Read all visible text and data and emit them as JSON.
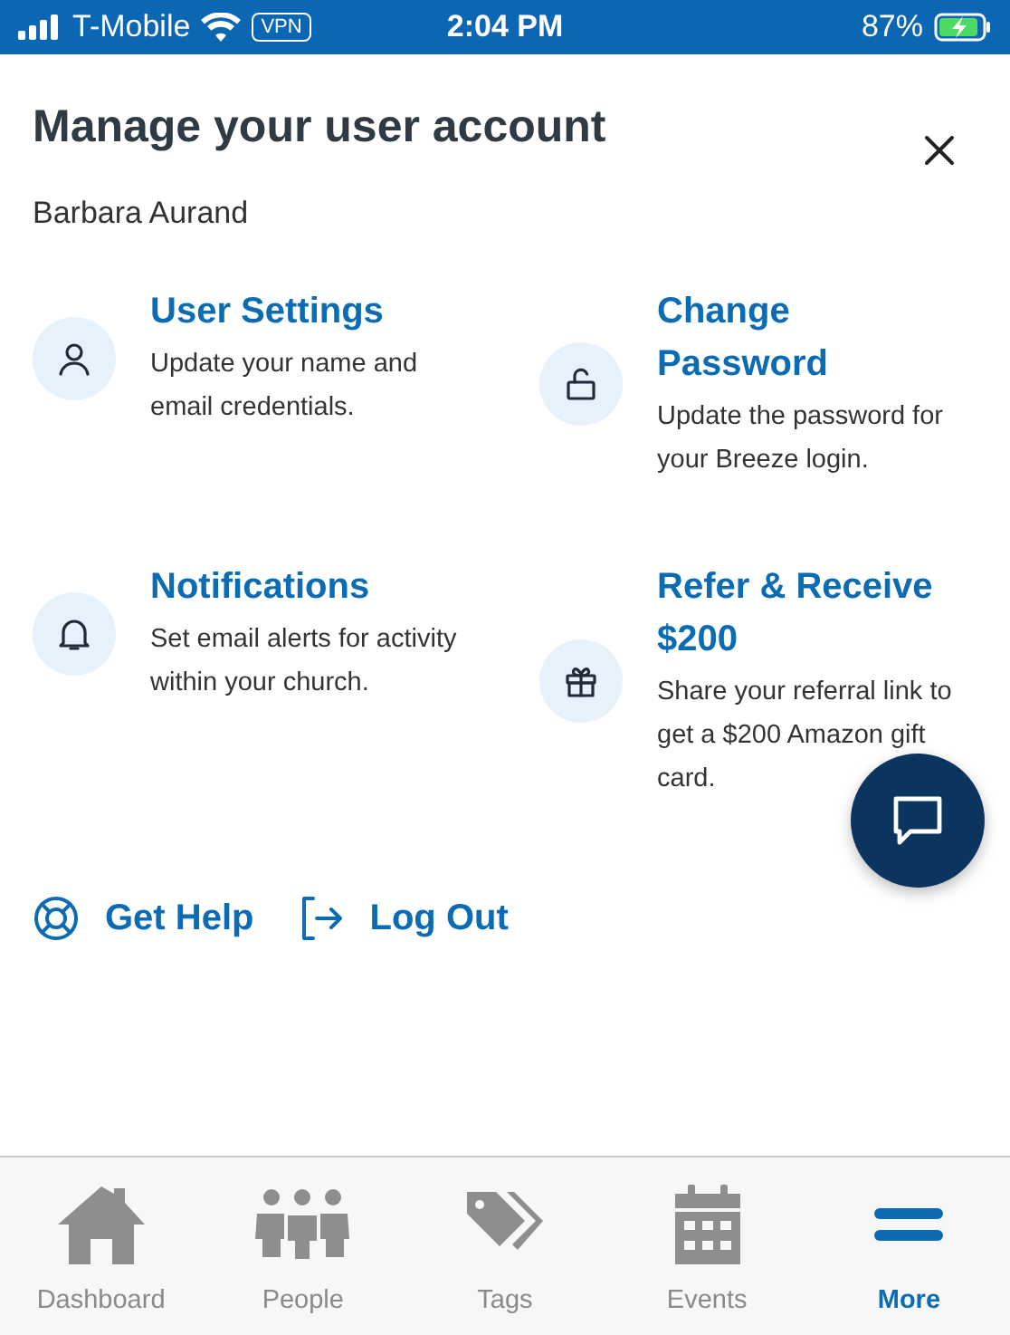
{
  "status_bar": {
    "carrier": "T-Mobile",
    "vpn": "VPN",
    "time": "2:04 PM",
    "battery": "87%"
  },
  "header": {
    "title": "Manage your user account",
    "user_name": "Barbara Aurand"
  },
  "cards": [
    {
      "kind": "user",
      "title": "User Settings",
      "description": "Update your name and email credentials."
    },
    {
      "kind": "lock",
      "title": "Change Password",
      "description": "Update the password for your Breeze login."
    },
    {
      "kind": "bell",
      "title": "Notifications",
      "description": "Set email alerts for activity within your church."
    },
    {
      "kind": "gift",
      "title": "Refer & Receive $200",
      "description": "Share your referral link to get a $200 Amazon gift card."
    }
  ],
  "links": [
    {
      "kind": "help",
      "label": "Get Help"
    },
    {
      "kind": "logout",
      "label": "Log Out"
    }
  ],
  "tab_bar": [
    {
      "kind": "home",
      "label": "Dashboard",
      "selected": false
    },
    {
      "kind": "people",
      "label": "People",
      "selected": false
    },
    {
      "kind": "tags",
      "label": "Tags",
      "selected": false
    },
    {
      "kind": "events",
      "label": "Events",
      "selected": false
    },
    {
      "kind": "more",
      "label": "More",
      "selected": true
    }
  ]
}
